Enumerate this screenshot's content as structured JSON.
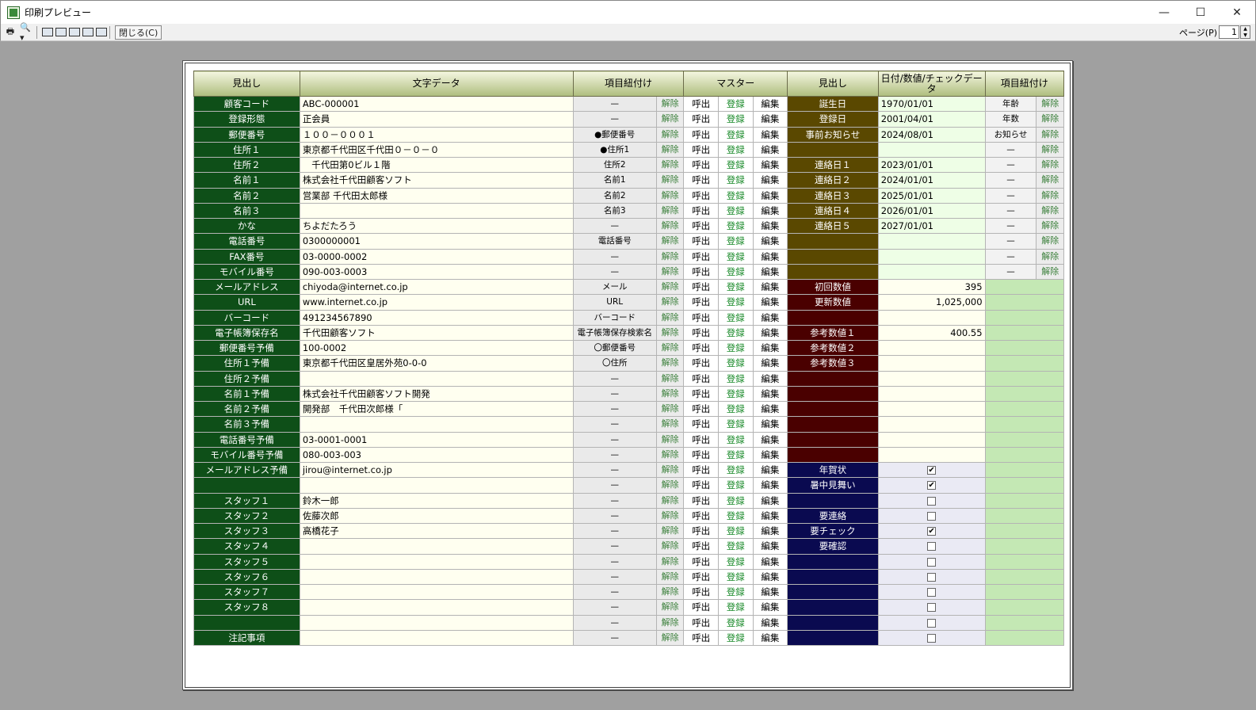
{
  "window": {
    "title": "印刷プレビュー",
    "minimize": "—",
    "maximize": "☐",
    "close": "✕"
  },
  "toolbar": {
    "close_label": "閉じる(C)",
    "page_label": "ページ(P)",
    "page_value": "1"
  },
  "headers": [
    "見出し",
    "文字データ",
    "項目紐付け",
    "マスター",
    "見出し",
    "日付/数値/チェックデータ",
    "項目紐付け"
  ],
  "buttons": {
    "unlink": "解除",
    "call": "呼出",
    "register": "登録",
    "edit": "編集"
  },
  "rows": [
    {
      "label": "顧客コード",
      "text": "ABC-000001",
      "link": "—",
      "r_label": "誕生日",
      "r_value": "1970/01/01",
      "r_link": "年齢"
    },
    {
      "label": "登録形態",
      "text": "正会員",
      "link": "—",
      "r_label": "登録日",
      "r_value": "2001/04/01",
      "r_link": "年数"
    },
    {
      "label": "郵便番号",
      "text": "１００－０００１",
      "link": "●郵便番号",
      "r_label": "事前お知らせ",
      "r_value": "2024/08/01",
      "r_link": "お知らせ"
    },
    {
      "label": "住所１",
      "text": "東京都千代田区千代田０－０－０",
      "link": "●住所1",
      "r_label": "",
      "r_value": "",
      "r_link": "—"
    },
    {
      "label": "住所２",
      "text": "　千代田第0ビル１階",
      "link": "住所2",
      "r_label": "連絡日１",
      "r_value": "2023/01/01",
      "r_link": "—"
    },
    {
      "label": "名前１",
      "text": "株式会社千代田顧客ソフト",
      "link": "名前1",
      "r_label": "連絡日２",
      "r_value": "2024/01/01",
      "r_link": "—"
    },
    {
      "label": "名前２",
      "text": "営業部 千代田太郎様",
      "link": "名前2",
      "r_label": "連絡日３",
      "r_value": "2025/01/01",
      "r_link": "—"
    },
    {
      "label": "名前３",
      "text": "",
      "link": "名前3",
      "r_label": "連絡日４",
      "r_value": "2026/01/01",
      "r_link": "—"
    },
    {
      "label": "かな",
      "text": "ちよだたろう",
      "link": "—",
      "r_label": "連絡日５",
      "r_value": "2027/01/01",
      "r_link": "—"
    },
    {
      "label": "電話番号",
      "text": "0300000001",
      "link": "電話番号",
      "r_label": "",
      "r_value": "",
      "r_link": "—"
    },
    {
      "label": "FAX番号",
      "text": "03-0000-0002",
      "link": "—",
      "r_label": "",
      "r_value": "",
      "r_link": "—"
    },
    {
      "label": "モバイル番号",
      "text": "090-003-0003",
      "link": "—",
      "r_label": "",
      "r_value": "",
      "r_link": "—"
    },
    {
      "label": "メールアドレス",
      "text": "chiyoda@internet.co.jp",
      "link": "メール",
      "r_label": "初回数値",
      "r_value": "395"
    },
    {
      "label": "URL",
      "text": "www.internet.co.jp",
      "link": "URL",
      "r_label": "更新数値",
      "r_value": "1,025,000"
    },
    {
      "label": "バーコード",
      "text": "491234567890",
      "link": "バーコード",
      "r_label": "",
      "r_value": ""
    },
    {
      "label": "電子帳簿保存名",
      "text": "千代田顧客ソフト",
      "link": "電子帳簿保存検索名",
      "r_label": "参考数値１",
      "r_value": "400.55"
    },
    {
      "label": "郵便番号予備",
      "text": "100-0002",
      "link": "〇郵便番号",
      "r_label": "参考数値２",
      "r_value": ""
    },
    {
      "label": "住所１予備",
      "text": "東京都千代田区皇居外苑0-0-0",
      "link": "〇住所",
      "r_label": "参考数値３",
      "r_value": ""
    },
    {
      "label": "住所２予備",
      "text": "",
      "link": "—",
      "r_label": "",
      "r_value": ""
    },
    {
      "label": "名前１予備",
      "text": "株式会社千代田顧客ソフト開発",
      "link": "—",
      "r_label": "",
      "r_value": ""
    },
    {
      "label": "名前２予備",
      "text": "開発部　千代田次郎様「",
      "link": "—",
      "r_label": "",
      "r_value": ""
    },
    {
      "label": "名前３予備",
      "text": "",
      "link": "—",
      "r_label": "",
      "r_value": ""
    },
    {
      "label": "電話番号予備",
      "text": "03-0001-0001",
      "link": "—",
      "r_label": "",
      "r_value": ""
    },
    {
      "label": "モバイル番号予備",
      "text": "080-003-003",
      "link": "—",
      "r_label": "",
      "r_value": ""
    },
    {
      "label": "メールアドレス予備",
      "text": "jirou@internet.co.jp",
      "link": "—",
      "r_label": "年賀状",
      "r_check": true
    },
    {
      "label": "",
      "text": "",
      "link": "—",
      "r_label": "暑中見舞い",
      "r_check": true
    },
    {
      "label": "スタッフ１",
      "text": "鈴木一郎",
      "link": "—",
      "r_label": "",
      "r_check": false
    },
    {
      "label": "スタッフ２",
      "text": "佐藤次郎",
      "link": "—",
      "r_label": "要連絡",
      "r_check": false
    },
    {
      "label": "スタッフ３",
      "text": "高橋花子",
      "link": "—",
      "r_label": "要チェック",
      "r_check": true
    },
    {
      "label": "スタッフ４",
      "text": "",
      "link": "—",
      "r_label": "要確認",
      "r_check": false
    },
    {
      "label": "スタッフ５",
      "text": "",
      "link": "—",
      "r_label": "",
      "r_check": false
    },
    {
      "label": "スタッフ６",
      "text": "",
      "link": "—",
      "r_label": "",
      "r_check": false
    },
    {
      "label": "スタッフ７",
      "text": "",
      "link": "—",
      "r_label": "",
      "r_check": false
    },
    {
      "label": "スタッフ８",
      "text": "",
      "link": "—",
      "r_label": "",
      "r_check": false
    },
    {
      "label": "",
      "text": "",
      "link": "—",
      "r_label": "",
      "r_check": false
    },
    {
      "label": "注記事項",
      "text": "",
      "link": "—",
      "r_label": "",
      "r_check": false
    }
  ]
}
